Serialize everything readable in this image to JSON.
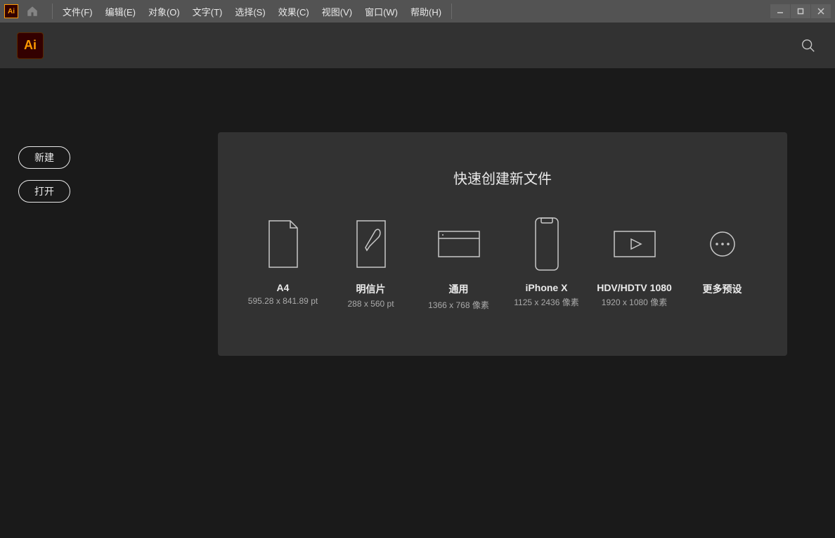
{
  "menu": {
    "file": "文件(F)",
    "edit": "编辑(E)",
    "object": "对象(O)",
    "type": "文字(T)",
    "select": "选择(S)",
    "effect": "效果(C)",
    "view": "视图(V)",
    "window": "窗口(W)",
    "help": "帮助(H)"
  },
  "logo_text": "Ai",
  "left": {
    "new": "新建",
    "open": "打开"
  },
  "panel": {
    "title": "快速创建新文件",
    "presets": [
      {
        "label": "A4",
        "dim": "595.28 x 841.89 pt"
      },
      {
        "label": "明信片",
        "dim": "288 x 560 pt"
      },
      {
        "label": "通用",
        "dim": "1366 x 768 像素"
      },
      {
        "label": "iPhone X",
        "dim": "1125 x 2436 像素"
      },
      {
        "label": "HDV/HDTV 1080",
        "dim": "1920 x 1080 像素"
      },
      {
        "label": "更多预设",
        "dim": ""
      }
    ]
  }
}
